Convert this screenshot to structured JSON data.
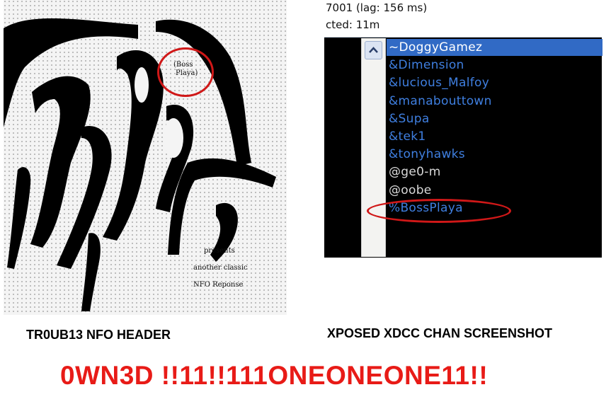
{
  "nfo": {
    "circled_label_line1": "(Boss",
    "circled_label_line2": "Playa)",
    "line1": "presents",
    "line2": "another classic",
    "line3": "NFO Reponse"
  },
  "chat": {
    "status_line1": "7001 (lag: 156 ms)",
    "status_line2": "cted: 11m",
    "scroll_up_icon": "chevron-up-icon",
    "selected_color": "#316ac5",
    "nicks": [
      {
        "text": "~DoggyGamez",
        "color": "#ffffff"
      },
      {
        "text": "&Dimension",
        "color": "#3f7fe0"
      },
      {
        "text": "&lucious_Malfoy",
        "color": "#3f7fe0"
      },
      {
        "text": "&manabouttown",
        "color": "#3f7fe0"
      },
      {
        "text": "&Supa",
        "color": "#3f7fe0"
      },
      {
        "text": "&tek1",
        "color": "#3f7fe0"
      },
      {
        "text": "&tonyhawks",
        "color": "#3f7fe0"
      },
      {
        "text": "@ge0-m",
        "color": "#d8d8d8"
      },
      {
        "text": "@oobe",
        "color": "#d8d8d8"
      },
      {
        "text": "%BossPlaya",
        "color": "#3f7fe0"
      }
    ]
  },
  "captions": {
    "left": "TR0UB13 NFO HEADER",
    "right": "XPOSED XDCC CHAN SCREENSHOT",
    "headline": "0WN3D !!11!!111ONEONEONE11!!"
  },
  "colors": {
    "highlight_circle": "#d01818",
    "headline": "#e81b17"
  }
}
